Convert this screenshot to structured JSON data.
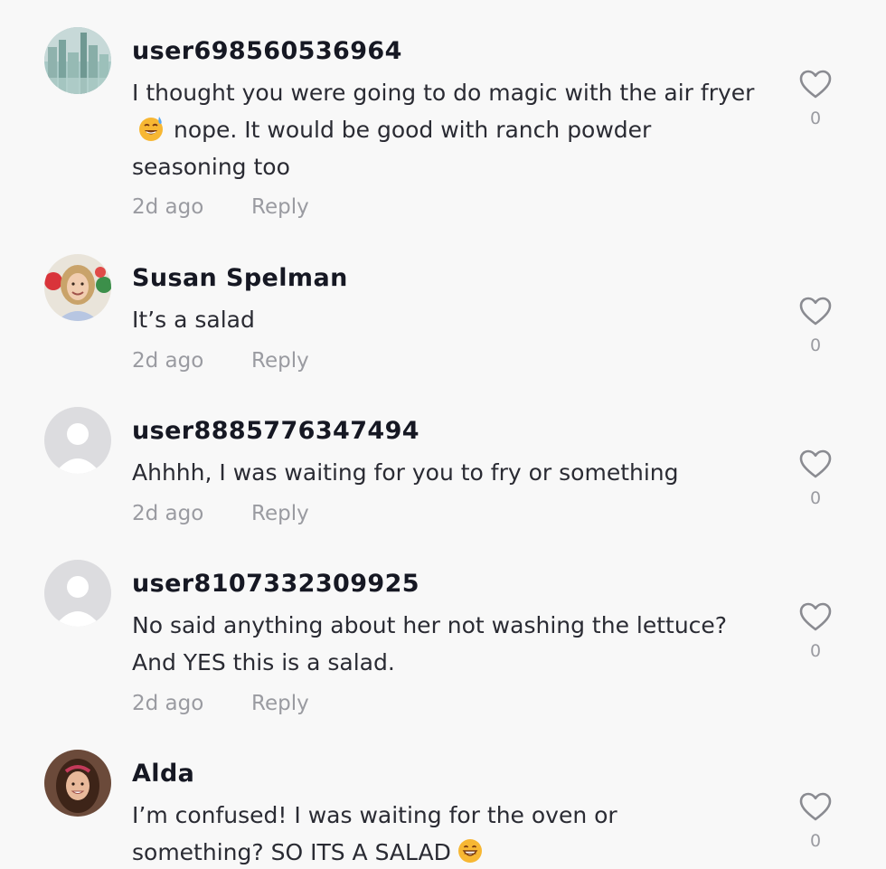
{
  "comments": [
    {
      "username": "user698560536964",
      "text_before_emoji": "I thought you were going to do magic with the air fryer",
      "emoji": "smiling-face-with-sweat-emoji",
      "text_after_emoji": "nope. It would be good with ranch powder seasoning too",
      "time": "2d ago",
      "reply_label": "Reply",
      "likes": "0",
      "avatar": "city-skyline-avatar"
    },
    {
      "username": "Susan Spelman",
      "text": "It’s a salad",
      "time": "2d ago",
      "reply_label": "Reply",
      "likes": "0",
      "avatar": "woman-photo-avatar"
    },
    {
      "username": "user8885776347494",
      "text": "Ahhhh, I was waiting for you to fry or something",
      "time": "2d ago",
      "reply_label": "Reply",
      "likes": "0",
      "avatar": "default-avatar"
    },
    {
      "username": "user8107332309925",
      "text": "No said anything about her not washing the lettuce? And YES this is a salad.",
      "time": "2d ago",
      "reply_label": "Reply",
      "likes": "0",
      "avatar": "default-avatar"
    },
    {
      "username": "Alda",
      "text_before_emoji": "I’m confused! I was waiting for the oven or something? SO ITS A SALAD",
      "emoji": "grinning-face-emoji",
      "text_after_emoji": "",
      "likes": "0",
      "avatar": "woman-photo-avatar"
    }
  ],
  "colors": {
    "background": "#f8f8f8",
    "username": "#161823",
    "text": "#2a2b33",
    "muted": "#9a9ba1",
    "heart_outline": "#8a8b91"
  }
}
